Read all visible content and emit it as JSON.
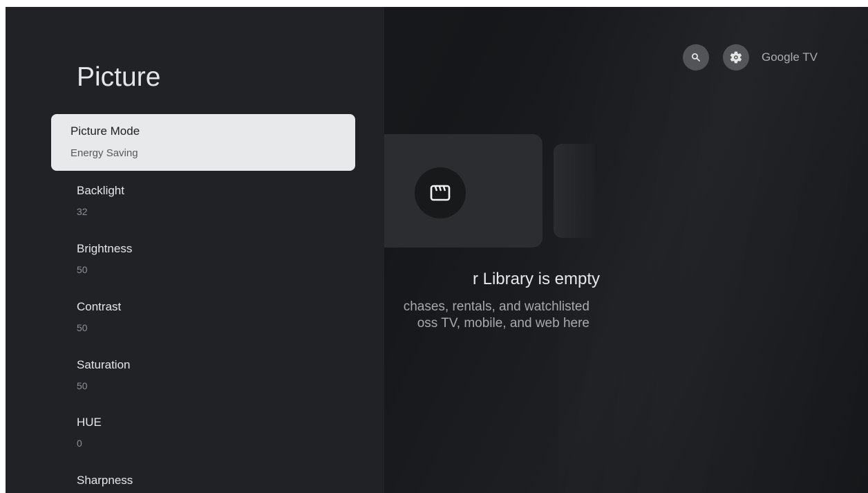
{
  "header": {
    "brand": "Google TV",
    "icons": [
      "search-icon",
      "gear-icon"
    ]
  },
  "library": {
    "icon": "clapperboard-icon",
    "title": "r Library is empty",
    "desc_line1": "chases, rentals, and watchlisted",
    "desc_line2": "oss TV, mobile, and web here"
  },
  "settings": {
    "title": "Picture",
    "items": [
      {
        "label": "Picture Mode",
        "value": "Energy Saving"
      },
      {
        "label": "Backlight",
        "value": "32"
      },
      {
        "label": "Brightness",
        "value": "50"
      },
      {
        "label": "Contrast",
        "value": "50"
      },
      {
        "label": "Saturation",
        "value": "50"
      },
      {
        "label": "HUE",
        "value": "0"
      },
      {
        "label": "Sharpness",
        "value": ""
      }
    ]
  },
  "colors": {
    "panel_bg": "#202226",
    "selected_bg": "#e8e9eb",
    "screen_bg": "#17191c"
  }
}
